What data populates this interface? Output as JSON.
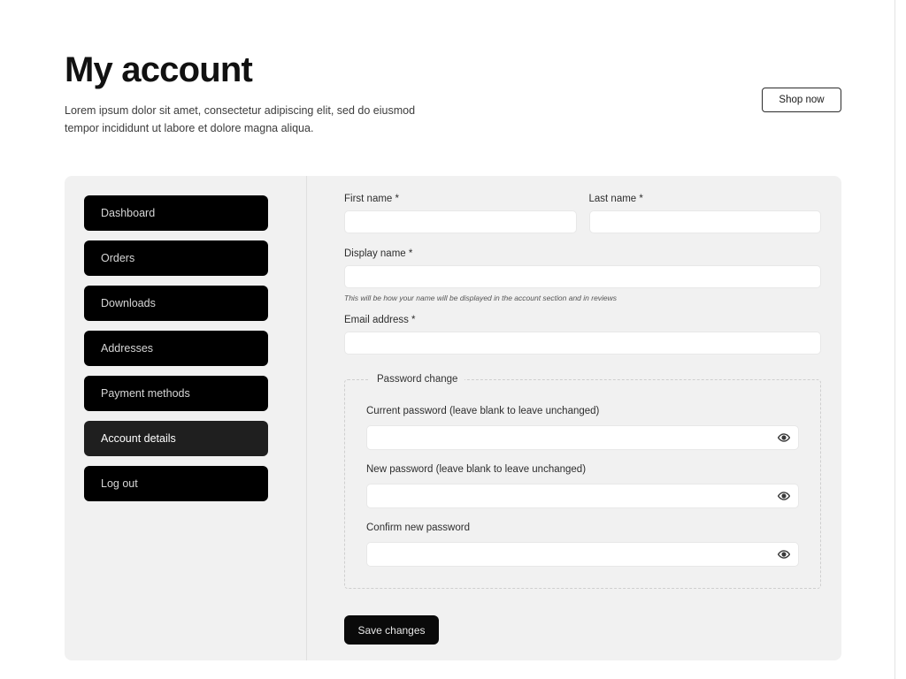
{
  "header": {
    "title": "My account",
    "subtitle": "Lorem ipsum dolor sit amet, consectetur adipiscing elit, sed do eiusmod tempor incididunt ut labore et dolore magna aliqua.",
    "shop_now_label": "Shop now"
  },
  "sidebar": {
    "items": [
      {
        "label": "Dashboard",
        "active": false
      },
      {
        "label": "Orders",
        "active": false
      },
      {
        "label": "Downloads",
        "active": false
      },
      {
        "label": "Addresses",
        "active": false
      },
      {
        "label": "Payment methods",
        "active": false
      },
      {
        "label": "Account details",
        "active": true
      },
      {
        "label": "Log out",
        "active": false
      }
    ]
  },
  "form": {
    "first_name": {
      "label": "First name *",
      "value": "",
      "placeholder": ""
    },
    "last_name": {
      "label": "Last name *",
      "value": "",
      "placeholder": ""
    },
    "display_name": {
      "label": "Display name *",
      "value": "",
      "placeholder": "",
      "helper": "This will be how your name will be displayed in the account section and in reviews"
    },
    "email": {
      "label": "Email address *",
      "value": "",
      "placeholder": ""
    },
    "password_section": {
      "legend": "Password change",
      "current_password": {
        "label": "Current password (leave blank to leave unchanged)",
        "value": "",
        "placeholder": ""
      },
      "new_password": {
        "label": "New password (leave blank to leave unchanged)",
        "value": "",
        "placeholder": ""
      },
      "confirm_password": {
        "label": "Confirm new password",
        "value": "",
        "placeholder": ""
      },
      "toggle_icon": "eye-icon"
    },
    "save_label": "Save changes"
  },
  "colors": {
    "nav_background": "#000000",
    "nav_active_background": "#1f1f1f",
    "card_background": "#f1f1f1",
    "page_background": "#ffffff",
    "button_primary": "#0a0a0a"
  }
}
